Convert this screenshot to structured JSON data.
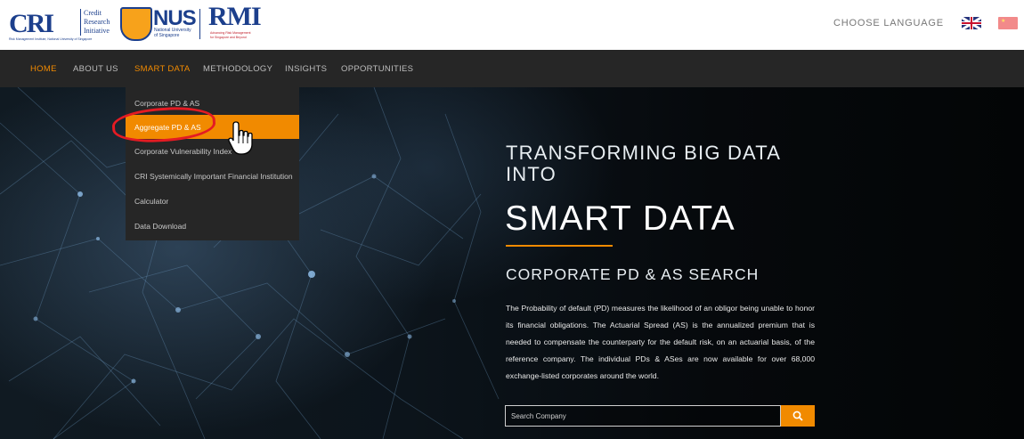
{
  "header": {
    "cri": {
      "mark": "CRI",
      "lines": [
        "Credit",
        "Research",
        "Initiative"
      ],
      "sub": "Risk Management Institute, National University of Singapore"
    },
    "nus": {
      "name": "NUS",
      "sub1": "National University",
      "sub2": "of Singapore"
    },
    "rmi": {
      "name": "RMI",
      "sub1": "Advancing Risk Management",
      "sub2": "for Singapore and Beyond"
    },
    "language_label": "CHOOSE LANGUAGE",
    "flags": [
      "uk-flag-icon",
      "china-flag-icon"
    ]
  },
  "nav": {
    "items": [
      {
        "label": "HOME",
        "active": true
      },
      {
        "label": "ABOUT US"
      },
      {
        "label": "SMART DATA"
      },
      {
        "label": "METHODOLOGY"
      },
      {
        "label": "INSIGHTS"
      },
      {
        "label": "OPPORTUNITIES"
      }
    ]
  },
  "dropdown": {
    "items": [
      {
        "label": "Corporate PD & AS"
      },
      {
        "label": "Aggregate PD & AS",
        "highlighted": true
      },
      {
        "label": "Corporate Vulnerability Index"
      },
      {
        "label": "CRI Systemically Important Financial Institution"
      },
      {
        "label": "Calculator"
      },
      {
        "label": "Data Download"
      }
    ]
  },
  "hero": {
    "line1": "TRANSFORMING BIG DATA INTO",
    "big": "SMART DATA",
    "subheading": "CORPORATE PD & AS SEARCH",
    "paragraph": "The Probability of default (PD) measures the likelihood of an obligor being unable to honor its financial obligations. The Actuarial Spread (AS) is the annualized premium that is needed to compensate the counterparty for the default risk, on an actuarial basis, of the reference company. The individual PDs & ASes are now available for over 68,000 exchange-listed corporates around the world.",
    "search_placeholder": "Search Company",
    "search_icon": "search-icon"
  },
  "colors": {
    "accent": "#f18a00",
    "nav_bg": "#262626",
    "annotation": "#e41b23",
    "brand_blue": "#1c3f8c"
  }
}
